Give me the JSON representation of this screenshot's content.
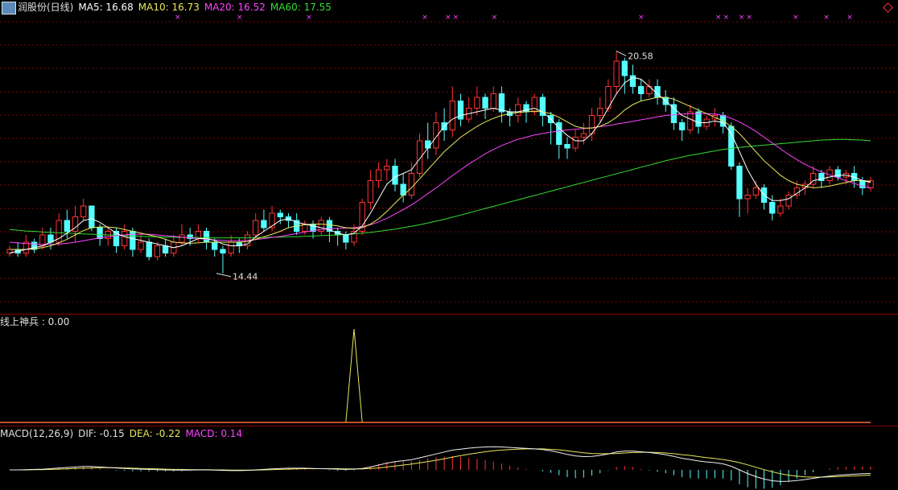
{
  "colors": {
    "bg": "#000000",
    "up": "#ff3333",
    "down": "#54ffff",
    "grid": "#8a0000",
    "ma5": "#ffffff",
    "ma10": "#e8e85a",
    "ma20": "#ff44ff",
    "ma60": "#33dd33",
    "text": "#e0e0e0"
  },
  "price_header": {
    "stock": "润股份(日线)",
    "ma5": "MA5: 16.68",
    "ma10": "MA10: 16.73",
    "ma20": "MA20: 16.52",
    "ma60": "MA60: 17.55",
    "icon": "chart-icon",
    "corner_icon": "diamond-icon"
  },
  "indicator_header": {
    "label": "线上神兵 : 0.00"
  },
  "macd_header": {
    "label": "MACD(12,26,9)",
    "dif": "DIF: -0.15",
    "dea": "DEA: -0.22",
    "macd": "MACD: 0.14"
  },
  "annotations": {
    "high_label": "20.58",
    "low_label": "14.44"
  },
  "chart_data": {
    "type": "candlestick",
    "y_min": 13.5,
    "y_max": 21.5,
    "candles": [
      [
        15.0,
        15.1,
        14.9,
        15.2
      ],
      [
        15.1,
        15.0,
        14.9,
        15.3
      ],
      [
        15.0,
        15.3,
        14.9,
        15.5
      ],
      [
        15.3,
        15.1,
        15.0,
        15.4
      ],
      [
        15.2,
        15.5,
        15.1,
        15.7
      ],
      [
        15.5,
        15.3,
        15.1,
        15.7
      ],
      [
        15.3,
        15.9,
        15.2,
        16.1
      ],
      [
        15.9,
        15.6,
        15.4,
        16.2
      ],
      [
        15.6,
        16.0,
        15.3,
        16.3
      ],
      [
        16.0,
        16.3,
        15.9,
        16.5
      ],
      [
        16.3,
        15.7,
        15.6,
        16.3
      ],
      [
        15.7,
        15.4,
        15.2,
        15.8
      ],
      [
        15.4,
        15.6,
        15.2,
        15.7
      ],
      [
        15.6,
        15.2,
        15.0,
        15.7
      ],
      [
        15.2,
        15.6,
        15.1,
        15.8
      ],
      [
        15.6,
        15.1,
        14.9,
        15.7
      ],
      [
        15.1,
        15.3,
        15.0,
        15.5
      ],
      [
        15.3,
        14.9,
        14.8,
        15.4
      ],
      [
        14.9,
        15.2,
        14.8,
        15.3
      ],
      [
        15.2,
        15.0,
        14.9,
        15.4
      ],
      [
        15.0,
        15.3,
        14.9,
        15.5
      ],
      [
        15.3,
        15.5,
        15.2,
        15.8
      ],
      [
        15.5,
        15.4,
        15.2,
        15.7
      ],
      [
        15.4,
        15.6,
        15.3,
        15.8
      ],
      [
        15.6,
        15.3,
        15.1,
        15.7
      ],
      [
        15.3,
        15.1,
        14.9,
        15.4
      ],
      [
        15.1,
        15.0,
        14.44,
        15.2
      ],
      [
        15.0,
        15.3,
        14.9,
        15.5
      ],
      [
        15.3,
        15.2,
        15.0,
        15.4
      ],
      [
        15.2,
        15.5,
        15.1,
        15.6
      ],
      [
        15.5,
        15.9,
        15.4,
        16.1
      ],
      [
        15.9,
        15.7,
        15.6,
        16.2
      ],
      [
        15.7,
        16.1,
        15.6,
        16.3
      ],
      [
        16.1,
        16.0,
        15.8,
        16.2
      ],
      [
        16.0,
        15.9,
        15.7,
        16.1
      ],
      [
        15.9,
        15.6,
        15.5,
        16.1
      ],
      [
        15.6,
        15.8,
        15.5,
        15.9
      ],
      [
        15.8,
        15.6,
        15.4,
        15.9
      ],
      [
        15.6,
        15.9,
        15.5,
        16.0
      ],
      [
        15.9,
        15.6,
        15.3,
        16.0
      ],
      [
        15.6,
        15.5,
        15.2,
        15.7
      ],
      [
        15.5,
        15.3,
        15.1,
        15.6
      ],
      [
        15.3,
        15.6,
        15.2,
        15.8
      ],
      [
        15.6,
        16.4,
        15.5,
        16.5
      ],
      [
        16.4,
        17.0,
        16.2,
        17.3
      ],
      [
        17.0,
        17.3,
        16.8,
        17.5
      ],
      [
        17.3,
        17.4,
        17.0,
        17.6
      ],
      [
        17.4,
        16.9,
        16.7,
        17.6
      ],
      [
        16.9,
        16.6,
        16.4,
        17.2
      ],
      [
        16.6,
        17.2,
        16.5,
        17.5
      ],
      [
        17.2,
        18.1,
        17.1,
        18.3
      ],
      [
        18.1,
        17.9,
        17.6,
        18.6
      ],
      [
        17.9,
        18.6,
        17.7,
        18.9
      ],
      [
        18.6,
        18.4,
        18.1,
        19.0
      ],
      [
        18.4,
        19.2,
        18.2,
        19.6
      ],
      [
        19.2,
        18.7,
        18.5,
        19.4
      ],
      [
        18.7,
        19.0,
        18.6,
        19.3
      ],
      [
        19.0,
        19.3,
        18.8,
        19.6
      ],
      [
        19.3,
        19.0,
        18.7,
        19.4
      ],
      [
        19.0,
        19.4,
        18.9,
        19.6
      ],
      [
        19.4,
        18.9,
        18.6,
        19.6
      ],
      [
        18.9,
        18.8,
        18.5,
        19.0
      ],
      [
        18.8,
        19.1,
        18.6,
        19.3
      ],
      [
        19.1,
        18.9,
        18.6,
        19.2
      ],
      [
        18.9,
        19.3,
        18.8,
        19.4
      ],
      [
        19.3,
        18.8,
        18.5,
        19.4
      ],
      [
        18.8,
        18.6,
        18.0,
        18.9
      ],
      [
        18.6,
        18.0,
        17.6,
        18.7
      ],
      [
        18.0,
        17.9,
        17.6,
        18.2
      ],
      [
        17.9,
        18.2,
        17.8,
        18.4
      ],
      [
        18.2,
        18.3,
        18.0,
        18.6
      ],
      [
        18.3,
        18.8,
        18.1,
        19.0
      ],
      [
        18.8,
        19.0,
        18.6,
        19.3
      ],
      [
        19.0,
        19.6,
        18.9,
        19.8
      ],
      [
        19.6,
        20.3,
        19.4,
        20.58
      ],
      [
        20.3,
        19.9,
        19.4,
        20.4
      ],
      [
        19.9,
        19.6,
        19.4,
        20.2
      ],
      [
        19.6,
        19.4,
        19.2,
        19.8
      ],
      [
        19.4,
        19.6,
        19.3,
        19.8
      ],
      [
        19.6,
        19.3,
        19.1,
        19.8
      ],
      [
        19.3,
        19.1,
        18.9,
        19.5
      ],
      [
        19.1,
        18.6,
        18.4,
        19.3
      ],
      [
        18.6,
        18.4,
        18.1,
        18.7
      ],
      [
        18.4,
        18.9,
        18.3,
        19.1
      ],
      [
        18.9,
        18.5,
        18.3,
        19.0
      ],
      [
        18.5,
        18.7,
        18.4,
        18.8
      ],
      [
        18.7,
        18.8,
        18.5,
        19.0
      ],
      [
        18.8,
        18.5,
        18.3,
        18.9
      ],
      [
        18.5,
        17.4,
        17.3,
        18.6
      ],
      [
        17.4,
        16.5,
        16.0,
        17.5
      ],
      [
        16.5,
        16.6,
        16.1,
        16.8
      ],
      [
        16.6,
        16.8,
        16.5,
        17.0
      ],
      [
        16.8,
        16.4,
        16.2,
        16.9
      ],
      [
        16.4,
        16.1,
        15.9,
        16.6
      ],
      [
        16.1,
        16.3,
        16.0,
        16.5
      ],
      [
        16.3,
        16.6,
        16.2,
        16.7
      ],
      [
        16.6,
        16.8,
        16.5,
        17.0
      ],
      [
        16.8,
        16.9,
        16.6,
        17.0
      ],
      [
        16.9,
        17.2,
        16.8,
        17.4
      ],
      [
        17.2,
        17.0,
        16.8,
        17.3
      ],
      [
        17.0,
        17.3,
        16.9,
        17.4
      ],
      [
        17.3,
        17.1,
        17.0,
        17.4
      ],
      [
        17.1,
        17.2,
        16.9,
        17.3
      ],
      [
        17.2,
        17.0,
        16.8,
        17.4
      ],
      [
        17.0,
        16.8,
        16.6,
        17.1
      ],
      [
        16.8,
        17.0,
        16.7,
        17.1
      ]
    ],
    "ma5": [
      15.0,
      15.05,
      15.1,
      15.15,
      15.2,
      15.3,
      15.4,
      15.55,
      15.7,
      15.9,
      15.95,
      15.85,
      15.7,
      15.55,
      15.45,
      15.4,
      15.35,
      15.3,
      15.25,
      15.2,
      15.15,
      15.2,
      15.3,
      15.4,
      15.4,
      15.35,
      15.25,
      15.2,
      15.2,
      15.25,
      15.45,
      15.6,
      15.75,
      15.9,
      15.95,
      15.85,
      15.8,
      15.75,
      15.7,
      15.65,
      15.55,
      15.5,
      15.55,
      15.75,
      16.1,
      16.5,
      16.9,
      17.1,
      17.2,
      17.3,
      17.6,
      17.9,
      18.2,
      18.5,
      18.7,
      18.8,
      18.85,
      18.9,
      18.95,
      19.0,
      18.95,
      18.9,
      18.9,
      18.95,
      19.0,
      18.9,
      18.7,
      18.45,
      18.25,
      18.1,
      18.1,
      18.3,
      18.6,
      19.0,
      19.4,
      19.7,
      19.85,
      19.8,
      19.6,
      19.4,
      19.2,
      19.0,
      18.8,
      18.7,
      18.6,
      18.6,
      18.65,
      18.6,
      18.3,
      17.8,
      17.3,
      16.9,
      16.6,
      16.45,
      16.45,
      16.5,
      16.65,
      16.8,
      17.0,
      17.05,
      17.1,
      17.15,
      17.15,
      17.1,
      17.0,
      16.95
    ],
    "ma10": [
      15.1,
      15.1,
      15.1,
      15.12,
      15.15,
      15.2,
      15.28,
      15.38,
      15.5,
      15.62,
      15.7,
      15.72,
      15.72,
      15.7,
      15.65,
      15.6,
      15.55,
      15.5,
      15.45,
      15.38,
      15.3,
      15.28,
      15.27,
      15.28,
      15.3,
      15.3,
      15.3,
      15.3,
      15.3,
      15.32,
      15.38,
      15.45,
      15.52,
      15.6,
      15.7,
      15.75,
      15.78,
      15.8,
      15.8,
      15.78,
      15.75,
      15.7,
      15.68,
      15.7,
      15.8,
      15.95,
      16.15,
      16.38,
      16.6,
      16.8,
      17.05,
      17.3,
      17.55,
      17.8,
      18.0,
      18.2,
      18.35,
      18.5,
      18.62,
      18.72,
      18.8,
      18.85,
      18.88,
      18.9,
      18.92,
      18.9,
      18.85,
      18.75,
      18.62,
      18.5,
      18.45,
      18.45,
      18.5,
      18.6,
      18.75,
      18.95,
      19.1,
      19.2,
      19.25,
      19.3,
      19.3,
      19.25,
      19.15,
      19.05,
      18.95,
      18.85,
      18.75,
      18.65,
      18.5,
      18.3,
      18.05,
      17.8,
      17.55,
      17.35,
      17.15,
      17.0,
      16.9,
      16.85,
      16.8,
      16.82,
      16.85,
      16.9,
      16.95,
      17.0,
      17.0,
      16.98
    ],
    "ma20": [
      15.3,
      15.28,
      15.26,
      15.25,
      15.24,
      15.24,
      15.25,
      15.27,
      15.3,
      15.34,
      15.38,
      15.42,
      15.45,
      15.48,
      15.5,
      15.52,
      15.52,
      15.52,
      15.5,
      15.48,
      15.46,
      15.44,
      15.42,
      15.4,
      15.38,
      15.36,
      15.35,
      15.34,
      15.34,
      15.35,
      15.37,
      15.4,
      15.43,
      15.46,
      15.5,
      15.54,
      15.58,
      15.62,
      15.65,
      15.67,
      15.68,
      15.69,
      15.7,
      15.73,
      15.78,
      15.86,
      15.96,
      16.08,
      16.2,
      16.33,
      16.48,
      16.64,
      16.8,
      16.97,
      17.14,
      17.3,
      17.46,
      17.6,
      17.74,
      17.86,
      17.97,
      18.06,
      18.14,
      18.2,
      18.26,
      18.3,
      18.34,
      18.37,
      18.4,
      18.42,
      18.44,
      18.46,
      18.49,
      18.52,
      18.56,
      18.6,
      18.64,
      18.68,
      18.72,
      18.76,
      18.8,
      18.82,
      18.84,
      18.85,
      18.85,
      18.85,
      18.84,
      18.8,
      18.72,
      18.62,
      18.5,
      18.36,
      18.2,
      18.04,
      17.88,
      17.72,
      17.58,
      17.45,
      17.34,
      17.24,
      17.16,
      17.08,
      17.0,
      16.92,
      16.85,
      16.8
    ],
    "ma60": [
      15.65,
      15.63,
      15.61,
      15.6,
      15.58,
      15.57,
      15.56,
      15.55,
      15.54,
      15.53,
      15.52,
      15.51,
      15.5,
      15.49,
      15.48,
      15.47,
      15.46,
      15.45,
      15.45,
      15.44,
      15.44,
      15.43,
      15.43,
      15.43,
      15.42,
      15.42,
      15.42,
      15.42,
      15.42,
      15.42,
      15.43,
      15.43,
      15.44,
      15.44,
      15.45,
      15.45,
      15.46,
      15.47,
      15.48,
      15.49,
      15.5,
      15.51,
      15.53,
      15.55,
      15.57,
      15.6,
      15.63,
      15.66,
      15.7,
      15.74,
      15.78,
      15.83,
      15.88,
      15.93,
      15.99,
      16.05,
      16.11,
      16.17,
      16.23,
      16.29,
      16.35,
      16.41,
      16.47,
      16.53,
      16.59,
      16.65,
      16.71,
      16.77,
      16.83,
      16.89,
      16.95,
      17.01,
      17.07,
      17.13,
      17.19,
      17.25,
      17.31,
      17.37,
      17.43,
      17.49,
      17.55,
      17.6,
      17.65,
      17.7,
      17.74,
      17.78,
      17.82,
      17.86,
      17.89,
      17.92,
      17.94,
      17.96,
      17.98,
      18.0,
      18.02,
      18.04,
      18.06,
      18.08,
      18.1,
      18.12,
      18.13,
      18.14,
      18.14,
      18.13,
      18.12,
      18.1
    ],
    "indicator": {
      "spike_index": 42,
      "spike_value": 1
    },
    "macd": {
      "dif": [
        0.0,
        0.0,
        0.01,
        0.02,
        0.03,
        0.05,
        0.08,
        0.1,
        0.12,
        0.14,
        0.14,
        0.12,
        0.1,
        0.08,
        0.06,
        0.04,
        0.03,
        0.02,
        0.01,
        0.0,
        -0.01,
        -0.01,
        -0.01,
        0.0,
        0.0,
        -0.01,
        -0.02,
        -0.03,
        -0.03,
        -0.02,
        0.0,
        0.02,
        0.04,
        0.06,
        0.07,
        0.07,
        0.07,
        0.06,
        0.05,
        0.04,
        0.03,
        0.02,
        0.03,
        0.06,
        0.12,
        0.2,
        0.28,
        0.34,
        0.38,
        0.42,
        0.5,
        0.58,
        0.66,
        0.74,
        0.82,
        0.86,
        0.9,
        0.93,
        0.95,
        0.96,
        0.95,
        0.93,
        0.91,
        0.89,
        0.87,
        0.84,
        0.79,
        0.72,
        0.64,
        0.58,
        0.55,
        0.56,
        0.6,
        0.66,
        0.74,
        0.78,
        0.78,
        0.75,
        0.72,
        0.68,
        0.63,
        0.56,
        0.48,
        0.43,
        0.37,
        0.33,
        0.3,
        0.25,
        0.15,
        0.0,
        -0.15,
        -0.28,
        -0.38,
        -0.45,
        -0.48,
        -0.47,
        -0.44,
        -0.4,
        -0.35,
        -0.3,
        -0.26,
        -0.22,
        -0.2,
        -0.18,
        -0.16,
        -0.15
      ],
      "dea": [
        0.0,
        0.0,
        0.0,
        0.01,
        0.01,
        0.02,
        0.03,
        0.04,
        0.06,
        0.07,
        0.08,
        0.09,
        0.09,
        0.09,
        0.08,
        0.07,
        0.06,
        0.05,
        0.04,
        0.03,
        0.02,
        0.02,
        0.01,
        0.01,
        0.01,
        0.0,
        0.0,
        -0.01,
        -0.01,
        -0.01,
        -0.01,
        0.0,
        0.01,
        0.02,
        0.03,
        0.04,
        0.05,
        0.05,
        0.05,
        0.05,
        0.05,
        0.04,
        0.04,
        0.04,
        0.06,
        0.08,
        0.12,
        0.16,
        0.2,
        0.24,
        0.29,
        0.34,
        0.4,
        0.46,
        0.53,
        0.59,
        0.65,
        0.7,
        0.75,
        0.79,
        0.82,
        0.84,
        0.86,
        0.87,
        0.87,
        0.87,
        0.85,
        0.83,
        0.79,
        0.75,
        0.71,
        0.68,
        0.67,
        0.67,
        0.68,
        0.7,
        0.72,
        0.73,
        0.73,
        0.72,
        0.7,
        0.67,
        0.63,
        0.6,
        0.55,
        0.51,
        0.47,
        0.43,
        0.37,
        0.3,
        0.21,
        0.11,
        0.01,
        -0.08,
        -0.16,
        -0.22,
        -0.26,
        -0.29,
        -0.3,
        -0.3,
        -0.29,
        -0.28,
        -0.26,
        -0.25,
        -0.23,
        -0.22
      ]
    }
  }
}
